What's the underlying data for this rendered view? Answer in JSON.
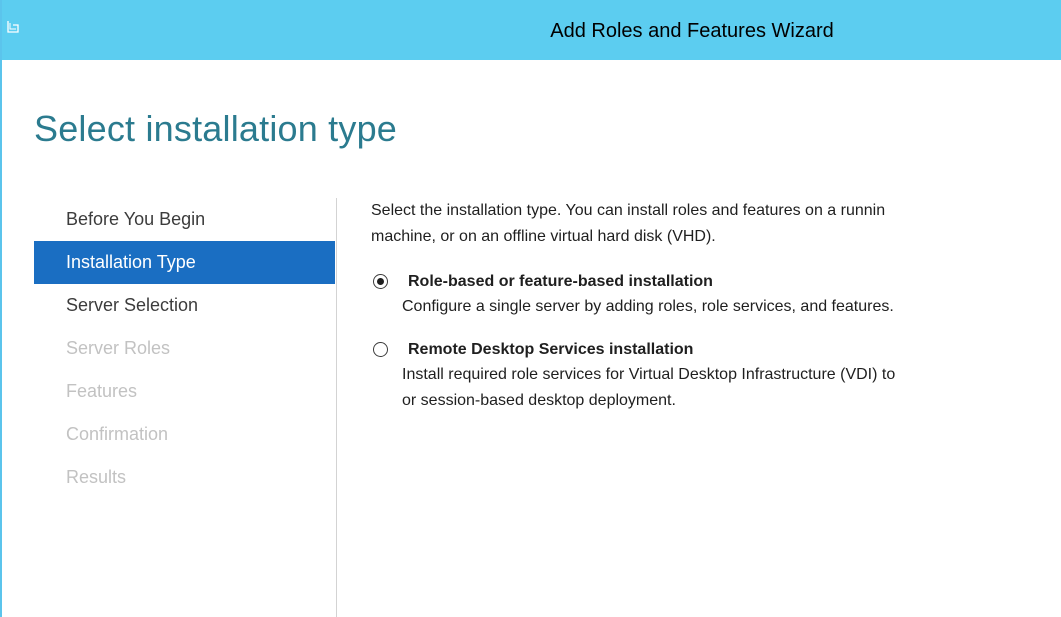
{
  "window": {
    "title": "Add Roles and Features Wizard",
    "accent_color": "#5ccdf0",
    "selected_color": "#1a6ec2"
  },
  "page": {
    "heading": "Select installation type"
  },
  "steps": [
    {
      "label": "Before You Begin",
      "state": "enabled"
    },
    {
      "label": "Installation Type",
      "state": "selected"
    },
    {
      "label": "Server Selection",
      "state": "enabled"
    },
    {
      "label": "Server Roles",
      "state": "disabled"
    },
    {
      "label": "Features",
      "state": "disabled"
    },
    {
      "label": "Confirmation",
      "state": "disabled"
    },
    {
      "label": "Results",
      "state": "disabled"
    }
  ],
  "content": {
    "intro_line1": "Select the installation type. You can install roles and features on a runnin",
    "intro_line2": "machine, or on an offline virtual hard disk (VHD).",
    "options": [
      {
        "label": "Role-based or feature-based installation",
        "desc_line1": "Configure a single server by adding roles, role services, and features.",
        "desc_line2": "",
        "checked": true
      },
      {
        "label": "Remote Desktop Services installation",
        "desc_line1": "Install required role services for Virtual Desktop Infrastructure (VDI) to",
        "desc_line2": "or session-based desktop deployment.",
        "checked": false
      }
    ]
  },
  "icons": {
    "app": "wizard-app-icon",
    "radio_checked": "radio-checked-icon",
    "radio_unchecked": "radio-unchecked-icon"
  }
}
